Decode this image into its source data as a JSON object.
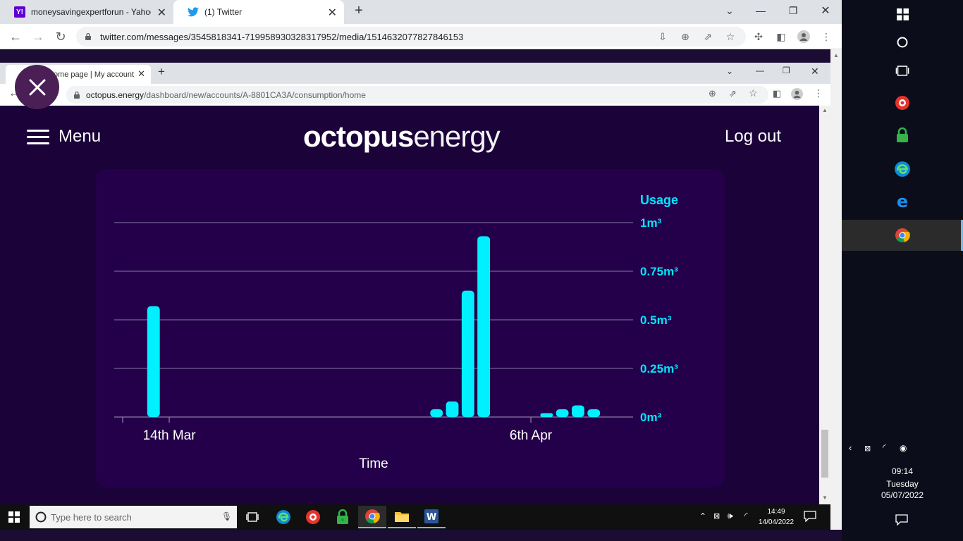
{
  "outer_browser": {
    "tabs": [
      {
        "title": "moneysavingexpertforun - Yahoo",
        "favicon": "Y!"
      },
      {
        "title": "(1) Twitter",
        "favicon": "twitter-bird"
      }
    ],
    "new_tab": "+",
    "url": "twitter.com/messages/3545818341-719958930328317952/media/1514632077827846153"
  },
  "inner_browser": {
    "tab_title": "Home page | My account |",
    "new_tab": "+",
    "url_domain": "octopus.energy",
    "url_path": "/dashboard/new/accounts/A-8801CA3A/consumption/home"
  },
  "site": {
    "menu_label": "Menu",
    "logo_bold": "octopus",
    "logo_light": "energy",
    "logout_label": "Log out",
    "colors": {
      "bg": "#1b0339",
      "card": "#25004a",
      "bar": "#00f0ff",
      "accent": "#00e6ff"
    }
  },
  "chart_data": {
    "type": "bar",
    "title": "",
    "ylabel": "Usage",
    "xlabel": "Time",
    "ylim": [
      0,
      1
    ],
    "y_ticks": [
      "0m³",
      "0.25m³",
      "0.5m³",
      "0.75m³",
      "1m³"
    ],
    "x_ticks": [
      {
        "label": "14th Mar",
        "index": 3
      },
      {
        "label": "6th Apr",
        "index": 26
      }
    ],
    "num_slots": 33,
    "values": [
      {
        "slot": 2,
        "value": 0.57
      },
      {
        "slot": 20,
        "value": 0.04
      },
      {
        "slot": 21,
        "value": 0.08
      },
      {
        "slot": 22,
        "value": 0.65
      },
      {
        "slot": 23,
        "value": 0.93
      },
      {
        "slot": 27,
        "value": 0.02
      },
      {
        "slot": 28,
        "value": 0.04
      },
      {
        "slot": 29,
        "value": 0.06
      },
      {
        "slot": 30,
        "value": 0.04
      }
    ]
  },
  "taskbar": {
    "search_placeholder": "Type here to search",
    "time": "14:49",
    "date": "14/04/2022"
  },
  "side_panel": {
    "time": "09:14",
    "day": "Tuesday",
    "date": "05/07/2022"
  }
}
